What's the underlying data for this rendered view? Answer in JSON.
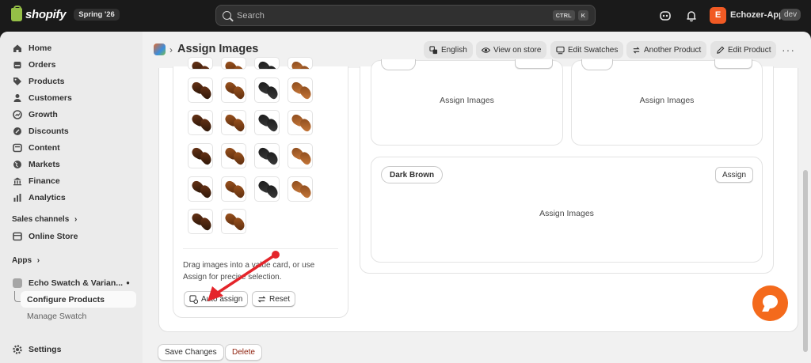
{
  "topbar": {
    "brand": "shopify",
    "edition": "Spring '26",
    "search_placeholder": "Search",
    "shortcut_keys": [
      "CTRL",
      "K"
    ],
    "store_initial": "E",
    "store_name": "Echozer-Apps",
    "store_tag": "dev"
  },
  "sidebar": {
    "items": [
      {
        "label": "Home",
        "icon": "home-icon"
      },
      {
        "label": "Orders",
        "icon": "orders-icon"
      },
      {
        "label": "Products",
        "icon": "tag-icon"
      },
      {
        "label": "Customers",
        "icon": "person-icon"
      },
      {
        "label": "Growth",
        "icon": "growth-icon"
      },
      {
        "label": "Discounts",
        "icon": "discount-icon"
      },
      {
        "label": "Content",
        "icon": "content-icon"
      },
      {
        "label": "Markets",
        "icon": "globe-icon"
      },
      {
        "label": "Finance",
        "icon": "bank-icon"
      },
      {
        "label": "Analytics",
        "icon": "bar-chart-icon"
      }
    ],
    "sales_channels_label": "Sales channels",
    "online_store_label": "Online Store",
    "apps_label": "Apps",
    "app_name": "Echo Swatch & Varian...",
    "app_subitems": [
      "Configure Products",
      "Manage Swatch"
    ],
    "settings_label": "Settings"
  },
  "header": {
    "title": "Assign Images",
    "buttons": [
      {
        "label": "English",
        "icon": "translate-icon"
      },
      {
        "label": "View on store",
        "icon": "eye-icon"
      },
      {
        "label": "Edit Swatches",
        "icon": "swatch-icon"
      },
      {
        "label": "Another Product",
        "icon": "swap-icon"
      },
      {
        "label": "Edit Product",
        "icon": "pencil-icon"
      }
    ],
    "more": "···"
  },
  "images_panel": {
    "help_text": "Drag images into a value card, or use Assign for precise selection.",
    "auto_assign_label": "Auto assign",
    "reset_label": "Reset"
  },
  "value_cards": [
    {
      "name": "",
      "assign_label": "",
      "placeholder": "Assign Images"
    },
    {
      "name": "",
      "assign_label": "",
      "placeholder": "Assign Images"
    },
    {
      "name": "Dark Brown",
      "assign_label": "Assign",
      "placeholder": "Assign Images"
    }
  ],
  "footer": {
    "save_label": "Save Changes",
    "delete_label": "Delete"
  },
  "colors": {
    "accent_red": "#e4252b",
    "store_badge": "#f15a24",
    "chat_button": "#f46a1c",
    "delete_text": "#8e1f0b"
  }
}
